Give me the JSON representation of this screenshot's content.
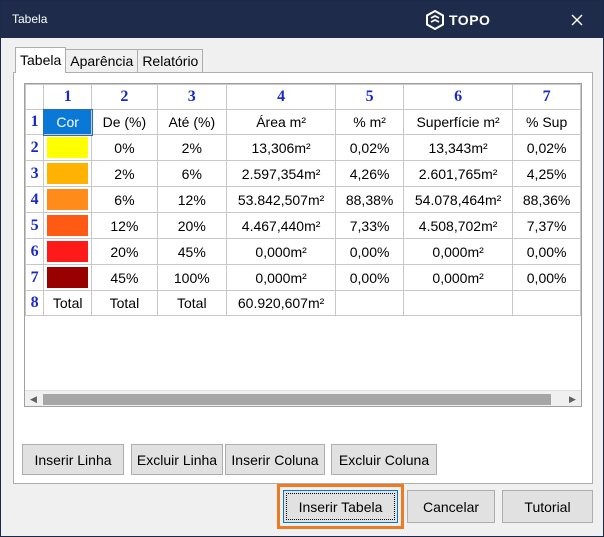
{
  "window": {
    "title": "Tabela",
    "logo_text": "TOPO",
    "close_icon": "close-icon"
  },
  "tabs": [
    {
      "label": "Tabela",
      "active": true
    },
    {
      "label": "Aparência",
      "active": false
    },
    {
      "label": "Relatório",
      "active": false
    }
  ],
  "grid": {
    "column_headers": [
      "1",
      "2",
      "3",
      "4",
      "5",
      "6",
      "7"
    ],
    "row_headers": [
      "1",
      "2",
      "3",
      "4",
      "5",
      "6",
      "7",
      "8"
    ],
    "header_row": [
      "Cor",
      "De (%)",
      "Até (%)",
      "Área m²",
      "% m²",
      "Superfície m²",
      "% Sup"
    ],
    "rows": [
      {
        "color": "#ffff00",
        "cells": [
          "0%",
          "2%",
          "13,306m²",
          "0,02%",
          "13,343m²",
          "0,02%"
        ]
      },
      {
        "color": "#ffb300",
        "cells": [
          "2%",
          "6%",
          "2.597,354m²",
          "4,26%",
          "2.601,765m²",
          "4,25%"
        ]
      },
      {
        "color": "#ff8c1a",
        "cells": [
          "6%",
          "12%",
          "53.842,507m²",
          "88,38%",
          "54.078,464m²",
          "88,36%"
        ]
      },
      {
        "color": "#ff5a14",
        "cells": [
          "12%",
          "20%",
          "4.467,440m²",
          "7,33%",
          "4.508,702m²",
          "7,37%"
        ]
      },
      {
        "color": "#ff1a1a",
        "cells": [
          "20%",
          "45%",
          "0,000m²",
          "0,00%",
          "0,000m²",
          "0,00%"
        ]
      },
      {
        "color": "#990000",
        "cells": [
          "45%",
          "100%",
          "0,000m²",
          "0,00%",
          "0,000m²",
          "0,00%"
        ]
      }
    ],
    "total_row": [
      "Total",
      "Total",
      "Total",
      "60.920,607m²",
      "",
      "",
      ""
    ]
  },
  "buttons": {
    "insert_row": "Inserir Linha",
    "delete_row": "Excluir Linha",
    "insert_column": "Inserir Coluna",
    "delete_column": "Excluir Coluna",
    "insert_table": "Inserir Tabela",
    "cancel": "Cancelar",
    "tutorial": "Tutorial"
  },
  "colors": {
    "titlebar": "#1e2b4b",
    "selection": "#0a78d7",
    "highlight": "#f07a22",
    "header_text": "#1a29c4"
  }
}
